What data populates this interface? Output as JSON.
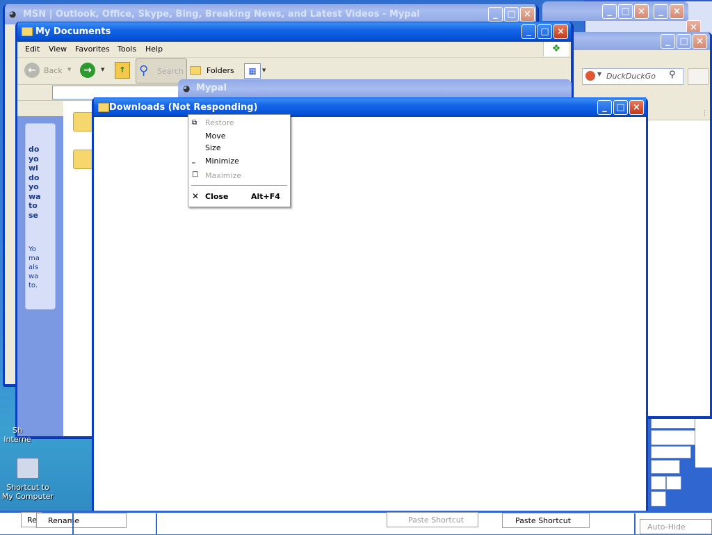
{
  "windows": {
    "msn": {
      "title": "MSN | Outlook, Office, Skype, Bing, Breaking News, and Latest Videos - Mypal"
    },
    "mydocs": {
      "title": "My Documents",
      "menu": [
        "Edit",
        "View",
        "Favorites",
        "Tools",
        "Help"
      ],
      "toolbar": {
        "back": "Back",
        "search": "Search",
        "folders": "Folders"
      },
      "sidepanel_text_a": [
        "do",
        "yo",
        "wi",
        "do",
        "yo",
        "wa",
        "to",
        "se"
      ],
      "sidepanel_text_b": [
        "Yo",
        "ma",
        "als",
        "wa",
        "to."
      ]
    },
    "mypal": {
      "title": "Mypal",
      "search_placeholder": "DuckDuckGo"
    },
    "downloads": {
      "title": "Downloads (Not Responding)"
    }
  },
  "context_menu": {
    "items": [
      {
        "label": "Restore",
        "enabled": false,
        "icon": "restore-icon"
      },
      {
        "label": "Move",
        "enabled": true
      },
      {
        "label": "Size",
        "enabled": true
      },
      {
        "label": "Minimize",
        "enabled": true,
        "icon": "minimize-icon"
      },
      {
        "label": "Maximize",
        "enabled": false,
        "icon": "maximize-icon"
      },
      {
        "label": "Close",
        "enabled": true,
        "shortcut": "Alt+F4",
        "icon": "close-icon"
      }
    ]
  },
  "desktop": {
    "icon1_label": "Shortcut to My Computer",
    "icon2_label_a": "Sh",
    "icon2_label_b": "Interne"
  },
  "taskbar_remnants": {
    "rename": "Rename",
    "re": "Re",
    "paste1": "Paste Shortcut",
    "paste2": "Paste Shortcut",
    "autohide": "Auto-Hide"
  },
  "colors": {
    "xp_blue": "#0552d6",
    "close_red": "#c23a1a",
    "window_bg": "#ece9d8"
  }
}
